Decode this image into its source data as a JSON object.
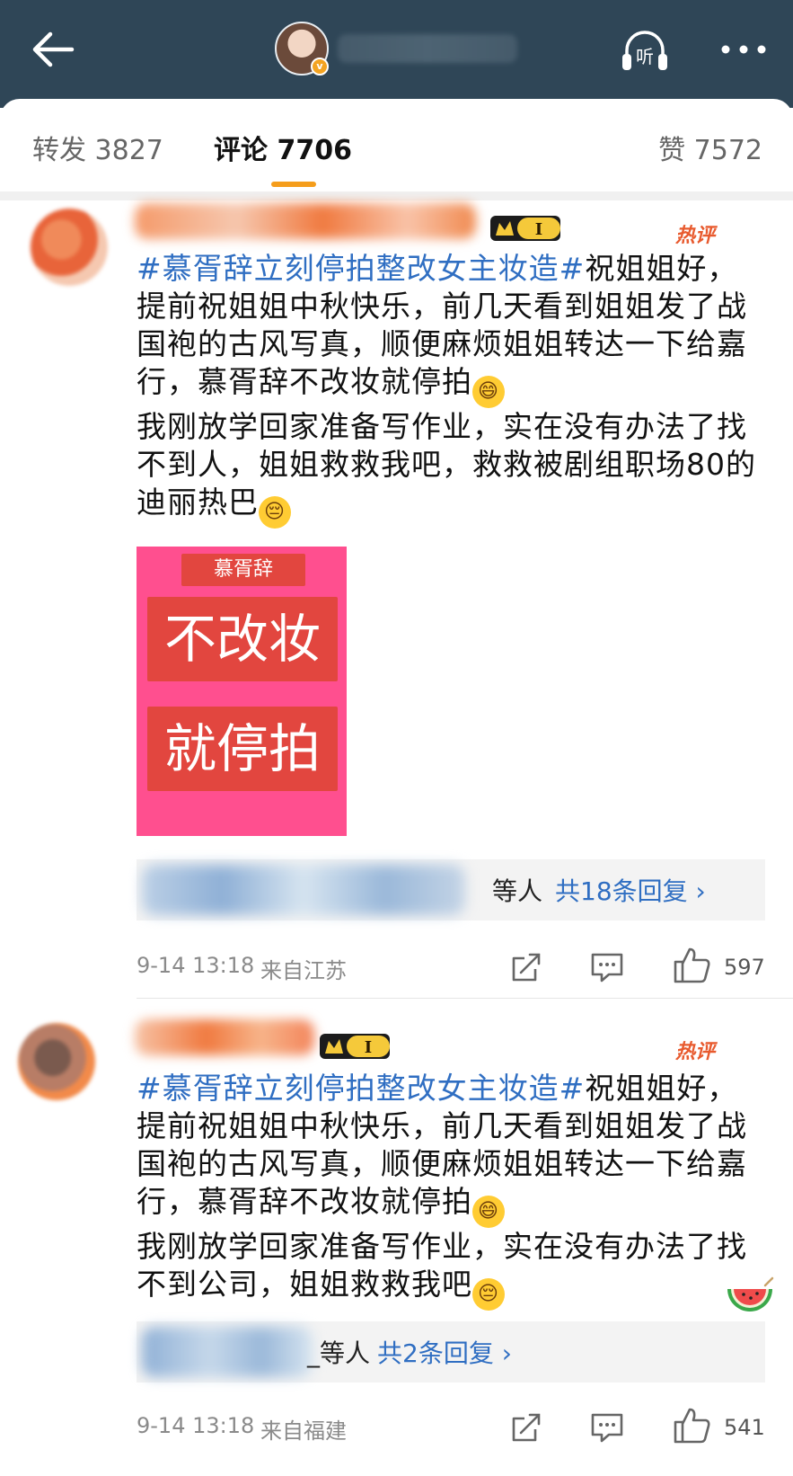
{
  "header": {
    "back_icon": "arrow-left-icon",
    "avatar_badge": "v",
    "listen_label": "听",
    "more_icon": "more-dots-icon"
  },
  "tabs": {
    "repost": "转发 3827",
    "comments": "评论 7706",
    "likes": "赞 7572",
    "active_color": "#f59d1b"
  },
  "comments": [
    {
      "hot": "热评",
      "tag": "#慕胥辞立刻停拍整改女主妆造#",
      "text_a": "祝姐姐好，提前祝姐姐中秋快乐，前几天看到姐姐发了战国袍的古风写真，顺便麻烦姐姐转达一下给嘉行，慕胥辞不改妆就停拍",
      "emoji_a": "😄",
      "text_b": "我刚放学回家准备写作业，实在没有办法了找不到人，姐姐救救我吧，救救被剧组职场80的迪丽热巴",
      "emoji_b": "😔",
      "image": {
        "label": "慕胥辞",
        "line1": "不改妆",
        "line2": "就停拍"
      },
      "reply_suffix": "等人",
      "reply_count": "共18条回复 ›",
      "time": "9-14 13:18",
      "location": "来自江苏",
      "likes": "597"
    },
    {
      "hot": "热评",
      "tag": "#慕胥辞立刻停拍整改女主妆造#",
      "text_a": "祝姐姐好，提前祝姐姐中秋快乐，前几天看到姐姐发了战国袍的古风写真，顺便麻烦姐姐转达一下给嘉行，慕胥辞不改妆就停拍",
      "emoji_a": "😄",
      "text_b": "我刚放学回家准备写作业，实在没有办法了找不到公司，姐姐救救我吧",
      "emoji_b": "😔",
      "reply_suffix": "_等人",
      "reply_count": "共2条回复 ›",
      "time": "9-14 13:18",
      "location": "来自福建",
      "likes": "541"
    }
  ],
  "colors": {
    "header_bg": "#2f4657",
    "topic_link": "#2f6ec2",
    "hot_label": "#e85a2e"
  }
}
